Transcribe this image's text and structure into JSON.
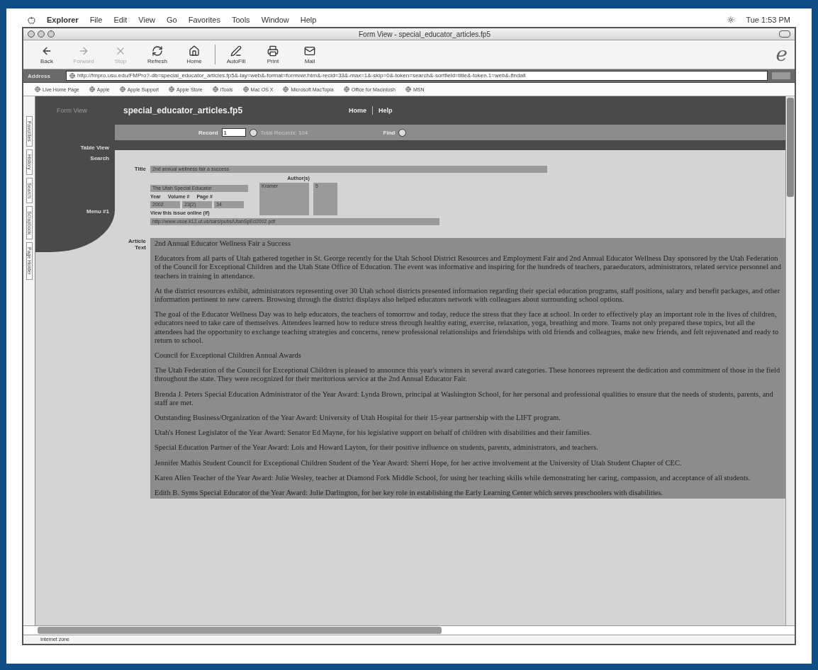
{
  "menu_bar": {
    "items": [
      "Explorer",
      "File",
      "Edit",
      "View",
      "Go",
      "Favorites",
      "Tools",
      "Window",
      "Help"
    ],
    "clock": "Tue 1:53 PM"
  },
  "window": {
    "title": "Form View - special_educator_articles.fp5"
  },
  "toolbar": [
    {
      "label": "Back",
      "kind": "back",
      "disabled": false
    },
    {
      "label": "Forward",
      "kind": "forward",
      "disabled": true
    },
    {
      "label": "Stop",
      "kind": "stop",
      "disabled": true
    },
    {
      "label": "Refresh",
      "kind": "refresh",
      "disabled": false
    },
    {
      "label": "Home",
      "kind": "home",
      "disabled": false
    },
    {
      "label": "AutoFill",
      "kind": "autofill",
      "disabled": false
    },
    {
      "label": "Print",
      "kind": "print",
      "disabled": false
    },
    {
      "label": "Mail",
      "kind": "mail",
      "disabled": false
    }
  ],
  "logo": "e",
  "address_bar": {
    "label": "Address",
    "value": "http://fmpro.usu.edu/FMPro?-db=special_educator_articles.fp5&-lay=web&-format=formvwr.htm&-recid=33&-max=1&-skip=0&-token=search&-sortfield=title&-token.1=web&-findall"
  },
  "favorites": [
    "Live Home Page",
    "Apple",
    "Apple Support",
    "Apple Store",
    "iTools",
    "Mac OS X",
    "Microsoft MacTopia",
    "Office for Macintosh",
    "MSN"
  ],
  "side_tabs": [
    "Favorites",
    "History",
    "Search",
    "Scrapbook",
    "Page Holder"
  ],
  "page": {
    "header": {
      "view": "Form View",
      "database": "special_educator_articles.fp5",
      "links": [
        "Home",
        "Help"
      ]
    },
    "nav": [
      "Table View",
      "Search",
      "Menu #1"
    ],
    "record_bar": {
      "label": "Record",
      "value": "1",
      "total": "Total Records: 104",
      "find": "Find"
    },
    "form": {
      "title_label": "Title",
      "title": "2nd annual wellness fair a success",
      "authors_label": "Author(s)",
      "authors": "Kramer",
      "author_count": "5",
      "journal": "The Utah Special Educator",
      "year_label": "Year",
      "volume_label": "Volume #",
      "page_label": "Page #",
      "year": "2002",
      "volume": "23(2)",
      "page": "34",
      "online_label": "View this issue online (if)",
      "online_url": "http://www.usoe.k12.ut.us/sars/pubs/UtahSpEd2002.pdf",
      "article_label": "Article Text",
      "article": [
        "2nd Annual Educator Wellness Fair a Success",
        "Educators from all parts of Utah gathered together in St. George recently for the Utah School District Resources and Employment Fair and 2nd Annual Educator Wellness Day sponsored by the Utah Federation of the Council for Exceptional Children and the Utah State Office of Education. The event was informative and inspiring for the hundreds of teachers, paraeducators, administrators, related service personnel and teachers in training in attendance.",
        "At the district resources exhibit, administrators representing over 30 Utah school districts presented information regarding their special education programs, staff positions, salary and benefit packages, and other information pertinent to new careers. Browsing through the district displays also helped educators network with colleagues about surrounding school options.",
        "The goal of the Educator Wellness Day was to help educators, the teachers of tomorrow and today, reduce the stress that they face at school. In order to effectively play an important role in the lives of children, educators need to take care of themselves. Attendees learned how to reduce stress through healthy eating, exercise, relaxation, yoga, breathing and more. Teams not only prepared these topics, but all the attendees had the opportunity to exchange teaching strategies and concerns, renew professional relationships and friendships with old friends and colleagues, make new friends, and felt rejuvenated and ready to return to school.",
        "Council for Exceptional Children Annual Awards",
        "The Utah Federation of the Council for Exceptional Children is pleased to announce this year's winners in several award categories. These honorees represent the dedication and commitment of those in the field throughout the state. They were recognized for their meritorious service at the 2nd Annual Educator Fair.",
        "Brenda J. Peters Special Education Administrator of the Year Award: Lynda Brown, principal at Washington School, for her personal and professional qualities to ensure that the needs of students, parents, and staff are met.",
        "Outstanding Business/Organization of the Year Award: University of Utah Hospital for their 15-year partnership with the LIFT program.",
        "Utah's Honest Legislator of the Year Award: Senator Ed Mayne, for his legislative support on behalf of children with disabilities and their families.",
        "Special Education Partner of the Year Award: Lois and Howard Layton, for their positive influence on students, parents, administrators, and teachers.",
        "Jennifer Mathis Student Council for Exceptional Children Student of the Year Award: Sherri Hope, for her active involvement at the University of Utah Student Chapter of CEC.",
        "Karen Allen Teacher of the Year Award: Julie Wesley, teacher at Diamond Fork Middle School, for using her teaching skills while demonstrating her caring, compassion, and acceptance of all students.",
        "Edith B. Syms Special Educator of the Year Award: Julie Darlington, for her key role in establishing the Early Learning Center which serves preschoolers with disabilities."
      ]
    }
  },
  "status_bar": {
    "zone": "Internet zone"
  }
}
